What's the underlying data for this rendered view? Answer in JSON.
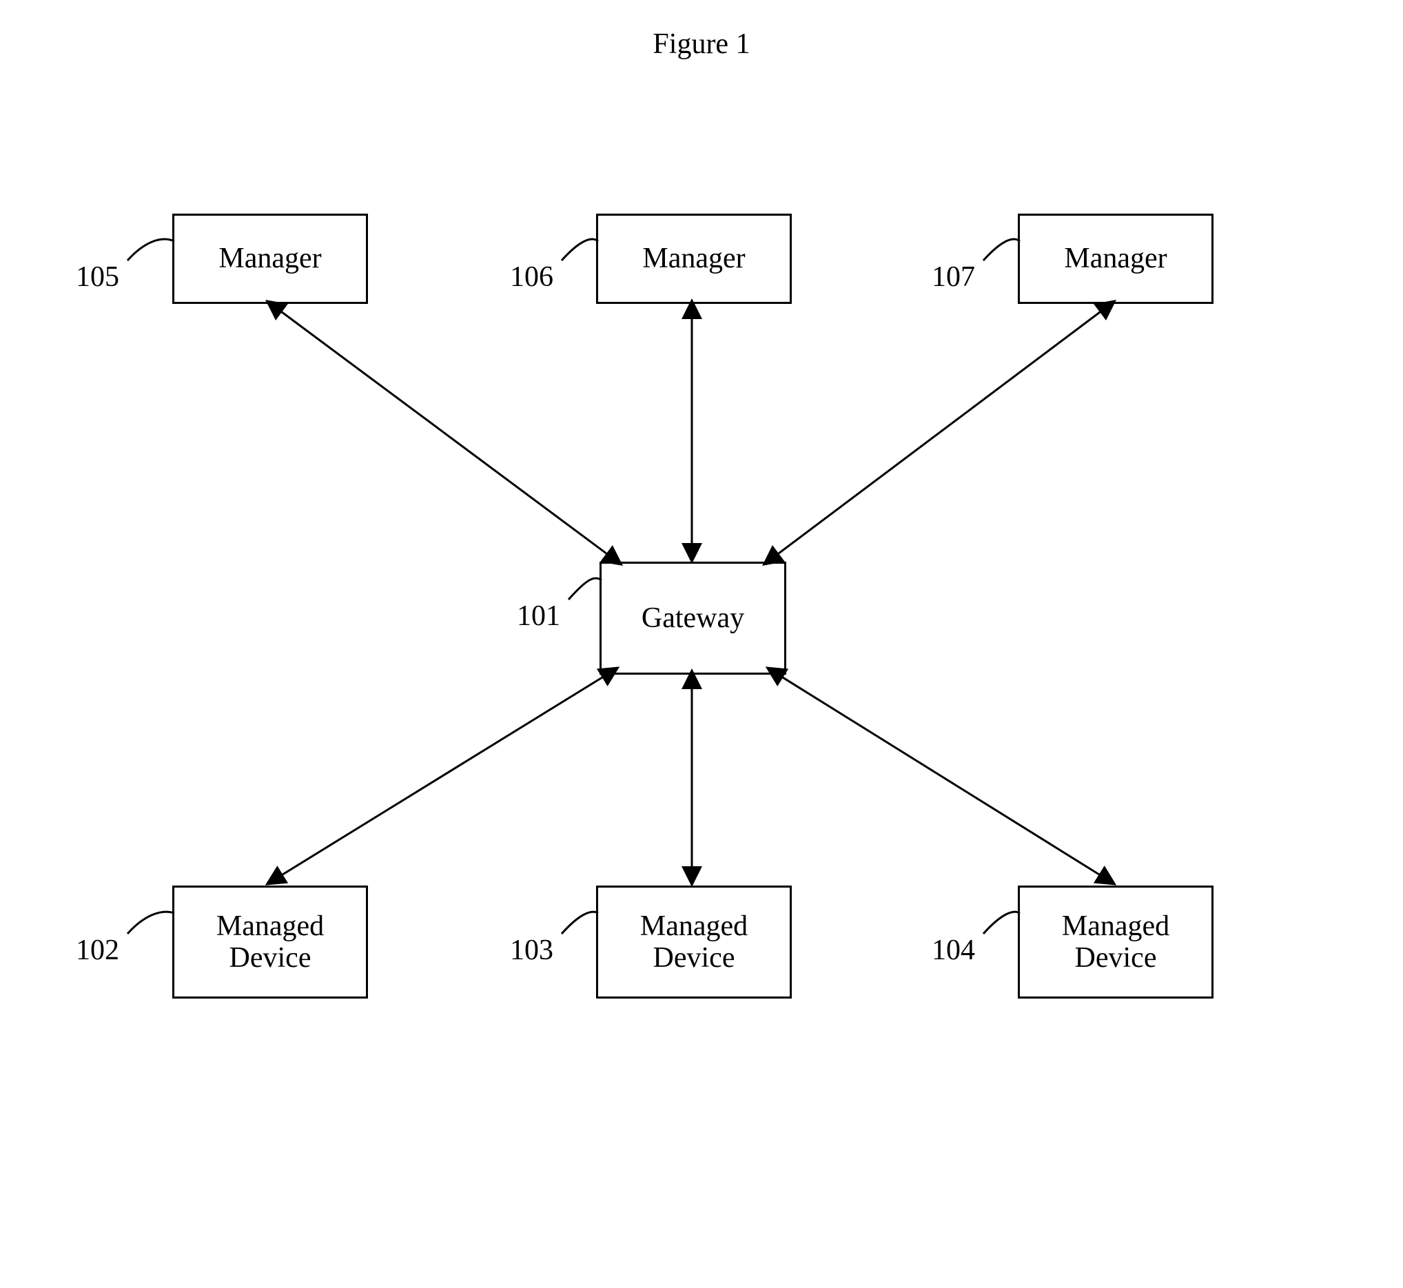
{
  "title": "Figure 1",
  "gateway": {
    "label": "Gateway",
    "ref": "101"
  },
  "managers": [
    {
      "label": "Manager",
      "ref": "105"
    },
    {
      "label": "Manager",
      "ref": "106"
    },
    {
      "label": "Manager",
      "ref": "107"
    }
  ],
  "devices": [
    {
      "label": "Managed\nDevice",
      "ref": "102"
    },
    {
      "label": "Managed\nDevice",
      "ref": "103"
    },
    {
      "label": "Managed\nDevice",
      "ref": "104"
    }
  ]
}
